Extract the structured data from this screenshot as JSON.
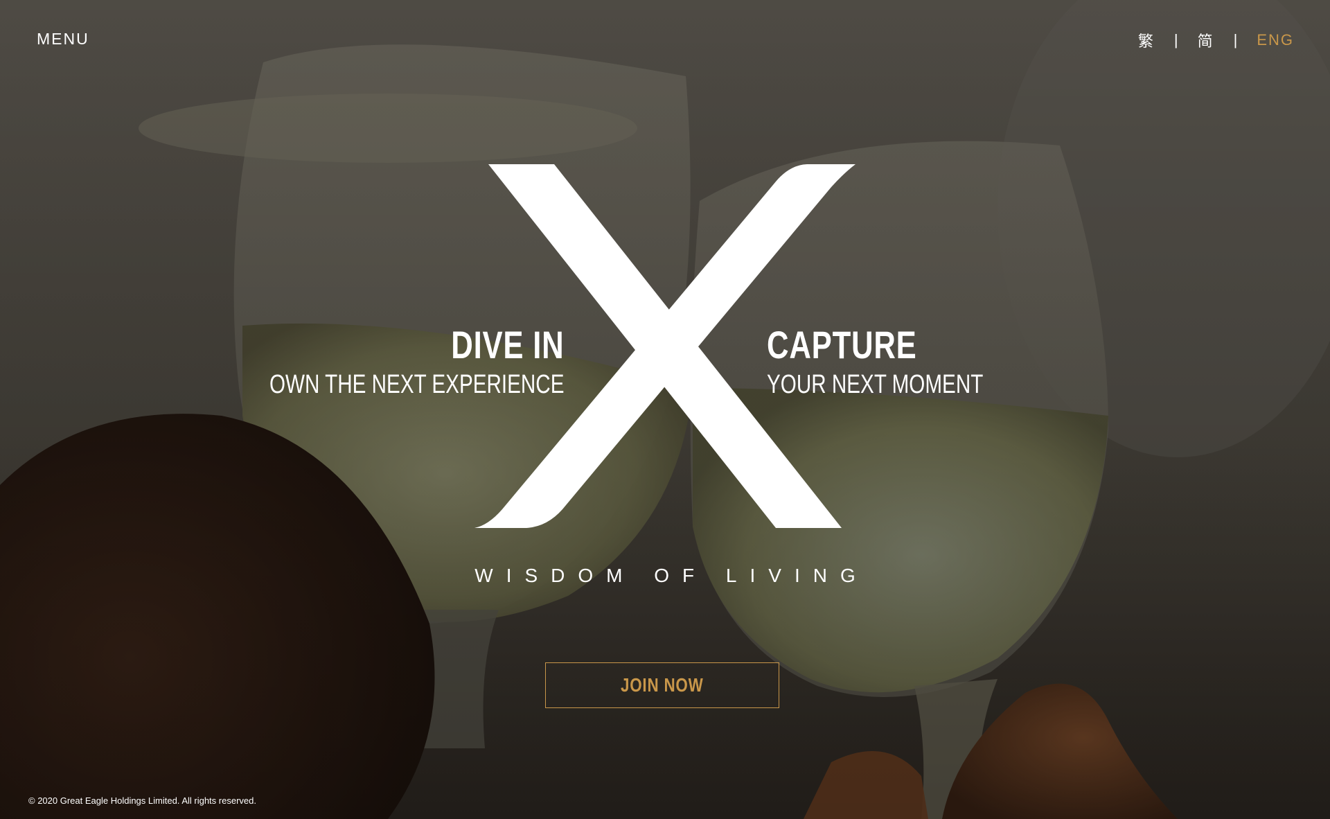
{
  "header": {
    "menu_label": "MENU",
    "languages": [
      {
        "label": "繁",
        "active": false
      },
      {
        "label": "简",
        "active": false
      },
      {
        "label": "ENG",
        "active": true
      }
    ],
    "separator": "|"
  },
  "hero": {
    "left": {
      "title": "DIVE IN",
      "subtitle": "OWN THE NEXT EXPERIENCE"
    },
    "right": {
      "title": "CAPTURE",
      "subtitle": "YOUR NEXT MOMENT"
    },
    "tagline": "WISDOM OF LIVING",
    "cta_label": "JOIN NOW",
    "logo_icon": "x-logo-icon",
    "background_image": "toasting-wine-glasses"
  },
  "footer": {
    "copyright": "© 2020 Great Eagle Holdings Limited. All rights reserved."
  },
  "colors": {
    "accent": "#c9974a",
    "text": "#ffffff",
    "overlay": "#2a2622"
  }
}
